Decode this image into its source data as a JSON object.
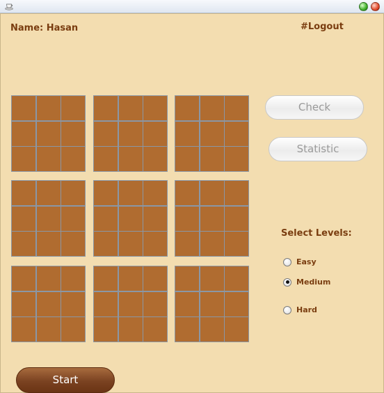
{
  "window": {
    "icon": "cup-icon",
    "controls": [
      "maximize-icon",
      "close-icon"
    ]
  },
  "header": {
    "user_name": "Name: Hasan",
    "logout_label": "#Logout"
  },
  "board": {
    "blocks": 9,
    "cells_per_block": 9,
    "cell_color": "#b06c30",
    "grid_line_color": "#8a97a6"
  },
  "actions": {
    "check_label": "Check",
    "statistic_label": "Statistic",
    "start_label": "Start"
  },
  "levels": {
    "title": "Select Levels:",
    "options": [
      {
        "label": "Easy",
        "selected": false
      },
      {
        "label": "Medium",
        "selected": true
      },
      {
        "label": "Hard",
        "selected": false
      }
    ]
  },
  "colors": {
    "background": "#f3ddb0",
    "text_brown": "#7a3d10",
    "start_button": "#7a4221"
  }
}
